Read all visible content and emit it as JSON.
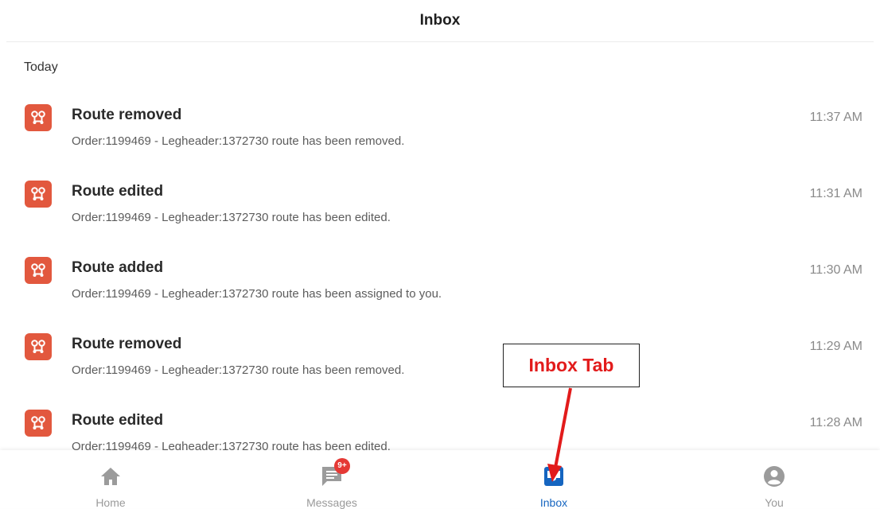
{
  "header": {
    "title": "Inbox"
  },
  "section": {
    "label": "Today"
  },
  "notifications": [
    {
      "title": "Route removed",
      "body": "Order:1199469 - Legheader:1372730 route has been removed.",
      "time": "11:37 AM",
      "icon": "route-icon"
    },
    {
      "title": "Route edited",
      "body": "Order:1199469 - Legheader:1372730 route has been edited.",
      "time": "11:31 AM",
      "icon": "route-icon"
    },
    {
      "title": "Route added",
      "body": "Order:1199469 - Legheader:1372730 route has been assigned to you.",
      "time": "11:30 AM",
      "icon": "route-icon"
    },
    {
      "title": "Route removed",
      "body": "Order:1199469 - Legheader:1372730 route has been removed.",
      "time": "11:29 AM",
      "icon": "route-icon"
    },
    {
      "title": "Route edited",
      "body": "Order:1199469 - Legheader:1372730 route has been edited.",
      "time": "11:28 AM",
      "icon": "route-icon"
    }
  ],
  "tabs": [
    {
      "label": "Home",
      "icon": "home-icon",
      "active": false
    },
    {
      "label": "Messages",
      "icon": "messages-icon",
      "badge": "9+",
      "active": false
    },
    {
      "label": "Inbox",
      "icon": "inbox-icon",
      "active": true
    },
    {
      "label": "You",
      "icon": "account-icon",
      "active": false
    }
  ],
  "annotation": {
    "label": "Inbox Tab"
  },
  "colors": {
    "accent": "#1565c0",
    "icon_bg": "#e2583e",
    "badge": "#e53935",
    "annotation": "#e21b1b"
  }
}
